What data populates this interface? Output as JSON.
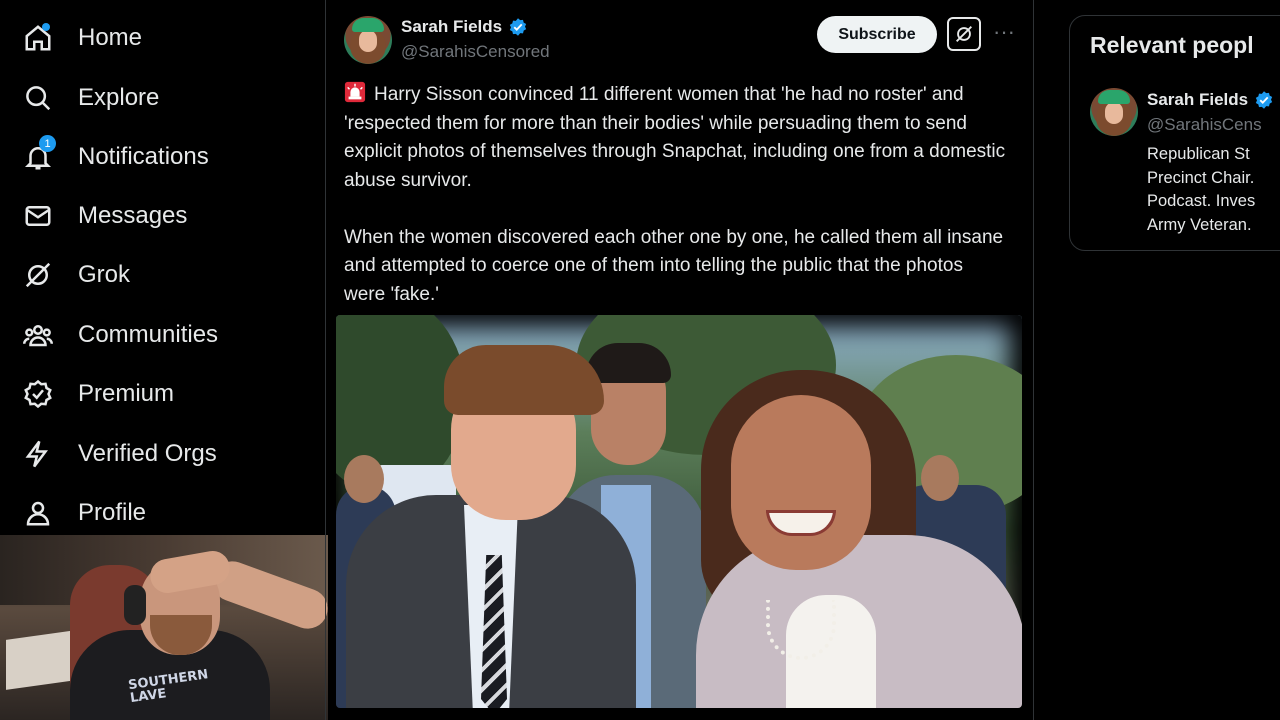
{
  "nav": {
    "items": [
      {
        "label": "Home",
        "icon": "home-icon"
      },
      {
        "label": "Explore",
        "icon": "search-icon"
      },
      {
        "label": "Notifications",
        "icon": "bell-icon",
        "badge": "1"
      },
      {
        "label": "Messages",
        "icon": "mail-icon"
      },
      {
        "label": "Grok",
        "icon": "grok-icon"
      },
      {
        "label": "Communities",
        "icon": "communities-icon"
      },
      {
        "label": "Premium",
        "icon": "premium-icon"
      },
      {
        "label": "Verified Orgs",
        "icon": "lightning-icon"
      },
      {
        "label": "Profile",
        "icon": "person-icon"
      }
    ]
  },
  "tweet": {
    "author_name": "Sarah Fields",
    "author_handle": "@SarahisCensored",
    "subscribe_label": "Subscribe",
    "more_label": "···",
    "text_p1": "Harry Sisson convinced 11 different women that 'he had no roster' and 'respected them for more than their bodies' while persuading them to send explicit photos of themselves through Snapchat, including one from a domestic abuse survivor.",
    "text_p2": "When the women discovered each other one by one, he called them all insane and attempted to coerce one of them into telling the public that the photos were 'fake.'",
    "emoji": "siren-icon"
  },
  "webcam": {
    "shirt_text": "SOUTHERN\nLAVE"
  },
  "right": {
    "title": "Relevant peopl",
    "person": {
      "name": "Sarah Fields",
      "handle": "@SarahisCens",
      "bio": "Republican St\nPrecinct Chair.\nPodcast. Inves\nArmy Veteran."
    }
  },
  "colors": {
    "accent": "#1d9bf0",
    "background": "#000000",
    "text": "#e7e9ea",
    "muted": "#71767b",
    "border": "#2f3336"
  }
}
